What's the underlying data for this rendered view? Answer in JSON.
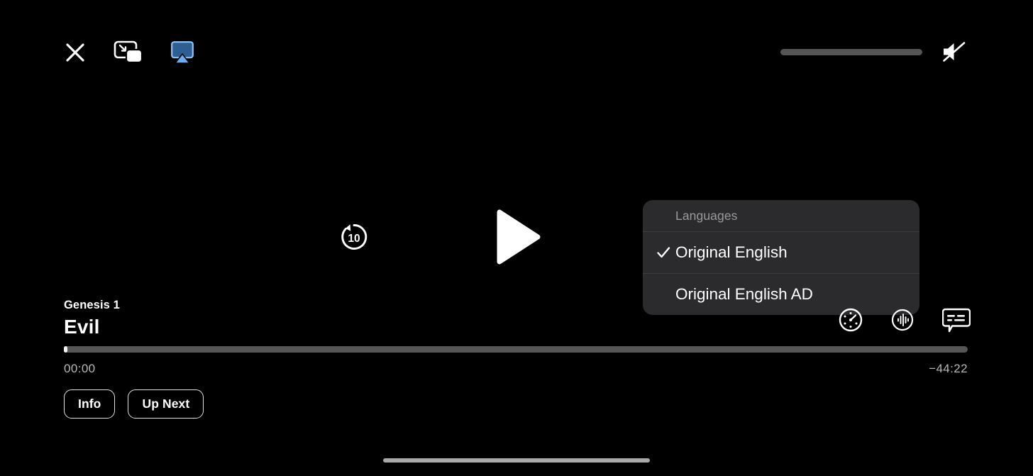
{
  "app": {
    "background_color": "#000000",
    "accent_color": "#3f8cff"
  },
  "top_bar": {
    "close_button": {
      "name": "close-icon",
      "label": "Close"
    },
    "pip_button": {
      "name": "picture-in-picture-icon",
      "label": "Picture in Picture"
    },
    "airplay_button": {
      "name": "airplay-icon",
      "label": "AirPlay",
      "color": "#5ea8f5"
    },
    "volume": {
      "name": "volume-slider",
      "level_percent": 0,
      "muted": true,
      "mute_icon_label": "Muted"
    }
  },
  "center_controls": {
    "skip_back": {
      "label": "10",
      "seconds": 10,
      "name": "skip-back-10-icon"
    },
    "play": {
      "label": "Play",
      "name": "play-icon",
      "state": "paused"
    }
  },
  "languages_menu": {
    "header": "Languages",
    "items": [
      {
        "label": "Original English",
        "selected": true
      },
      {
        "label": "Original English AD",
        "selected": false
      }
    ],
    "check_glyph": "✓"
  },
  "now_playing": {
    "subtitle": "Genesis 1",
    "title": "Evil"
  },
  "bottom_icons": [
    {
      "name": "playback-speed-icon",
      "label": "Playback Speed"
    },
    {
      "name": "audio-options-icon",
      "label": "Audio"
    },
    {
      "name": "subtitles-icon",
      "label": "Subtitles"
    }
  ],
  "scrubber": {
    "current_time": "00:00",
    "remaining_time": "−44:22",
    "progress_percent": 0
  },
  "pills": [
    {
      "label": "Info"
    },
    {
      "label": "Up Next"
    }
  ],
  "home_indicator": {
    "label": "Home Indicator"
  }
}
